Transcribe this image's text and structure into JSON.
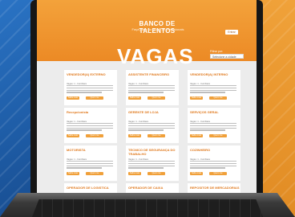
{
  "brand": {
    "name": "BANCO DE TALENTOS",
    "tagline": "Faça parte do grupo de profissionais",
    "header_button": "Entrar"
  },
  "page": {
    "title": "VAGAS"
  },
  "filter": {
    "label": "Filtrar por:",
    "selected": "Selecione a cidade"
  },
  "jobs": [
    {
      "title": "VENDEDOR(A) EXTERNO",
      "sub": "Vagas: 1 - Itumbiara",
      "more": "Saiba mais",
      "apply": "Quero me candidatar"
    },
    {
      "title": "ASSISTENTE FINANCEIRO",
      "sub": "Vagas: 1 - Itumbiara",
      "more": "Saiba mais",
      "apply": "Quero me candidatar"
    },
    {
      "title": "VENDEDOR(A) INTERNO",
      "sub": "Vagas: 1 - Itumbiara",
      "more": "Saiba mais",
      "apply": "Quero me candidatar"
    },
    {
      "title": "Recepcionista",
      "sub": "Vagas: 1 - Itumbiara",
      "more": "Saiba mais",
      "apply": "Quero me candidatar"
    },
    {
      "title": "GERENTE DE LOJA",
      "sub": "Vagas: 1 - Itumbiara",
      "more": "Saiba mais",
      "apply": "Quero me candidatar"
    },
    {
      "title": "SERVIÇOS GERAL",
      "sub": "Vagas: 1 - Itumbiara",
      "more": "Saiba mais",
      "apply": "Quero me candidatar"
    },
    {
      "title": "MOTORISTA",
      "sub": "Vagas: 1 - Itumbiara",
      "more": "Saiba mais",
      "apply": "Quero me candidatar"
    },
    {
      "title": "TECNICO DE SEGURANÇA DO TRABALHO",
      "sub": "Vagas: 1 - Itumbiara",
      "more": "Saiba mais",
      "apply": "Quero me candidatar"
    },
    {
      "title": "COZINHEIRO",
      "sub": "Vagas: 1 - Itumbiara",
      "more": "Saiba mais",
      "apply": "Quero me candidatar"
    },
    {
      "title": "OPERADOR DE LOGISTICA",
      "sub": "",
      "more": "",
      "apply": ""
    },
    {
      "title": "OPERADOR DE CAIXA",
      "sub": "",
      "more": "",
      "apply": ""
    },
    {
      "title": "REPOSITOR DE MERCADORIAS",
      "sub": "",
      "more": "",
      "apply": ""
    }
  ],
  "colors": {
    "accent": "#f0a03a",
    "title_orange": "#e07a1f",
    "header_orange": "#ec8a25",
    "background_blue": "#1f5ea8"
  }
}
